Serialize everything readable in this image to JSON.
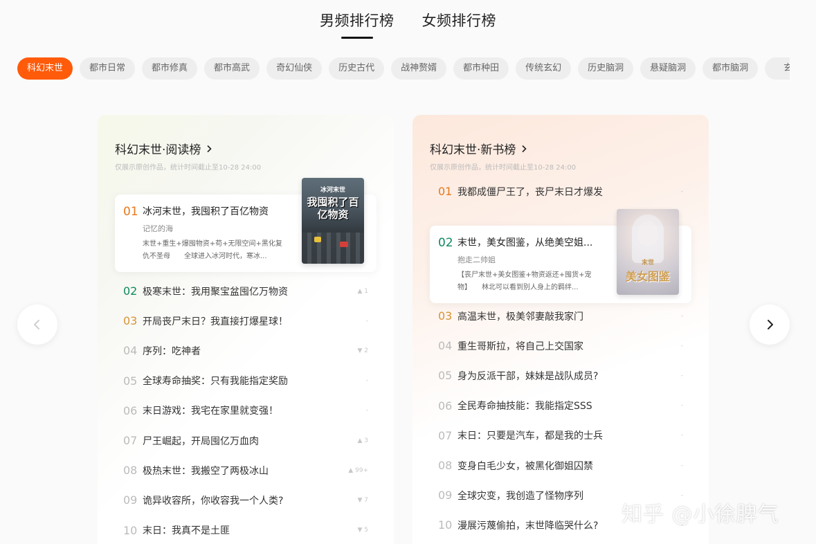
{
  "top_tabs": [
    {
      "label": "男频排行榜",
      "active": true
    },
    {
      "label": "女频排行榜",
      "active": false
    }
  ],
  "categories": [
    "科幻末世",
    "都市日常",
    "都市修真",
    "都市高武",
    "奇幻仙侠",
    "历史古代",
    "战神赘婿",
    "都市种田",
    "传统玄幻",
    "历史脑洞",
    "悬疑脑洞",
    "都市脑洞",
    "玄幻"
  ],
  "active_category_index": 0,
  "left_panel": {
    "title": "科幻末世·阅读榜",
    "subtitle": "仅展示原创作品，统计时间截止至10-28 24:00",
    "featured": {
      "rank": "01",
      "title": "冰河末世，我囤积了百亿物资",
      "author": "记忆的海",
      "desc": "末世+重生+爆囤物资+苟+无限空间+黑化复仇不圣母　　全球进入冰河时代，寒冰...",
      "cover_text_top": "冰河末世",
      "cover_text_main": "我囤积了百亿物资"
    },
    "items": [
      {
        "rank": "02",
        "title": "极寒末世：我用聚宝盆囤亿万物资",
        "trend": "▲ 1"
      },
      {
        "rank": "03",
        "title": "开局丧尸末日？我直接打爆星球！",
        "trend": "-"
      },
      {
        "rank": "04",
        "title": "序列：吃神者",
        "trend": "▼ 2"
      },
      {
        "rank": "05",
        "title": "全球寿命抽奖：只有我能指定奖励",
        "trend": "-"
      },
      {
        "rank": "06",
        "title": "末日游戏：我宅在家里就变强！",
        "trend": "-"
      },
      {
        "rank": "07",
        "title": "尸王崛起，开局囤亿万血肉",
        "trend": "▲ 3"
      },
      {
        "rank": "08",
        "title": "极热末世：我搬空了两极冰山",
        "trend": "▲ 99+"
      },
      {
        "rank": "09",
        "title": "诡异收容所，你收容我一个人类?",
        "trend": "▼ 7"
      },
      {
        "rank": "10",
        "title": "末日：我真不是土匪",
        "trend": "▼ 5"
      }
    ]
  },
  "right_panel": {
    "title": "科幻末世·新书榜",
    "subtitle": "仅展示原创作品，统计时间截止至10-28 24:00",
    "first": {
      "rank": "01",
      "title": "我都成僵尸王了，丧尸末日才爆发",
      "trend": "-"
    },
    "featured": {
      "rank": "02",
      "title": "末世，美女图鉴，从绝美空姐...",
      "author": "抱走二帅姐",
      "desc": "【丧尸末世+美女图鉴+物资返还+囤货+宠物】　　林北可以看到别人身上的羁绊...",
      "cover_text_top": "末世",
      "cover_text_main": "美女图鉴"
    },
    "items": [
      {
        "rank": "03",
        "title": "高温末世，极美邻妻敲我家门",
        "trend": "-"
      },
      {
        "rank": "04",
        "title": "重生哥斯拉，将自己上交国家",
        "trend": "-"
      },
      {
        "rank": "05",
        "title": "身为反派干部，妹妹是战队成员?",
        "trend": "-"
      },
      {
        "rank": "06",
        "title": "全民寿命抽技能：我能指定SSS",
        "trend": "-"
      },
      {
        "rank": "07",
        "title": "末日：只要是汽车，都是我的士兵",
        "trend": "-"
      },
      {
        "rank": "08",
        "title": "变身白毛少女，被黑化御姐囚禁",
        "trend": "-"
      },
      {
        "rank": "09",
        "title": "全球灾变，我创造了怪物序列",
        "trend": "-"
      },
      {
        "rank": "10",
        "title": "漫展污蔑偷拍，末世降临哭什么?",
        "trend": "-"
      }
    ]
  },
  "watermark": "知乎 @小徐脾气",
  "colors": {
    "accent": "#ff5b0a",
    "rank1": "#e6781e",
    "rank2": "#0f8a5f",
    "rank3": "#d89436"
  }
}
